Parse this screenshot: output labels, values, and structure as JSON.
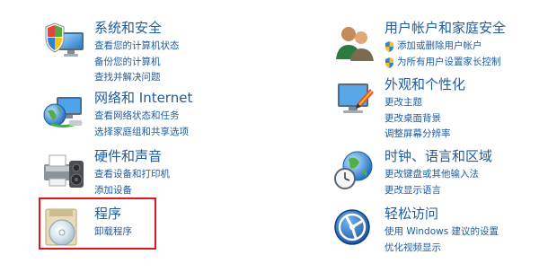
{
  "left": [
    {
      "title": "系统和安全",
      "links": [
        "查看您的计算机状态",
        "备份您的计算机",
        "查找并解决问题"
      ],
      "icon": "shield-monitor-icon"
    },
    {
      "title": "网络和 Internet",
      "links": [
        "查看网络状态和任务",
        "选择家庭组和共享选项"
      ],
      "icon": "network-globe-icon"
    },
    {
      "title": "硬件和声音",
      "links": [
        "查看设备和打印机",
        "添加设备"
      ],
      "icon": "printer-speaker-icon"
    },
    {
      "title": "程序",
      "links": [
        "卸载程序"
      ],
      "icon": "programs-disc-icon"
    }
  ],
  "right": [
    {
      "title": "用户帐户和家庭安全",
      "links": [
        "添加或删除用户帐户",
        "为所有用户设置家长控制"
      ],
      "icon": "users-icon"
    },
    {
      "title": "外观和个性化",
      "links": [
        "更改主题",
        "更改桌面背景",
        "调整屏幕分辨率"
      ],
      "icon": "appearance-monitor-icon"
    },
    {
      "title": "时钟、语言和区域",
      "links": [
        "更改键盘或其他输入法",
        "更改显示语言"
      ],
      "icon": "clock-globe-icon"
    },
    {
      "title": "轻松访问",
      "links": [
        "使用 Windows 建议的设置",
        "优化视频显示"
      ],
      "icon": "ease-of-access-icon"
    }
  ],
  "highlight_color": "#e0161c",
  "link_color": "#1e5b9f"
}
